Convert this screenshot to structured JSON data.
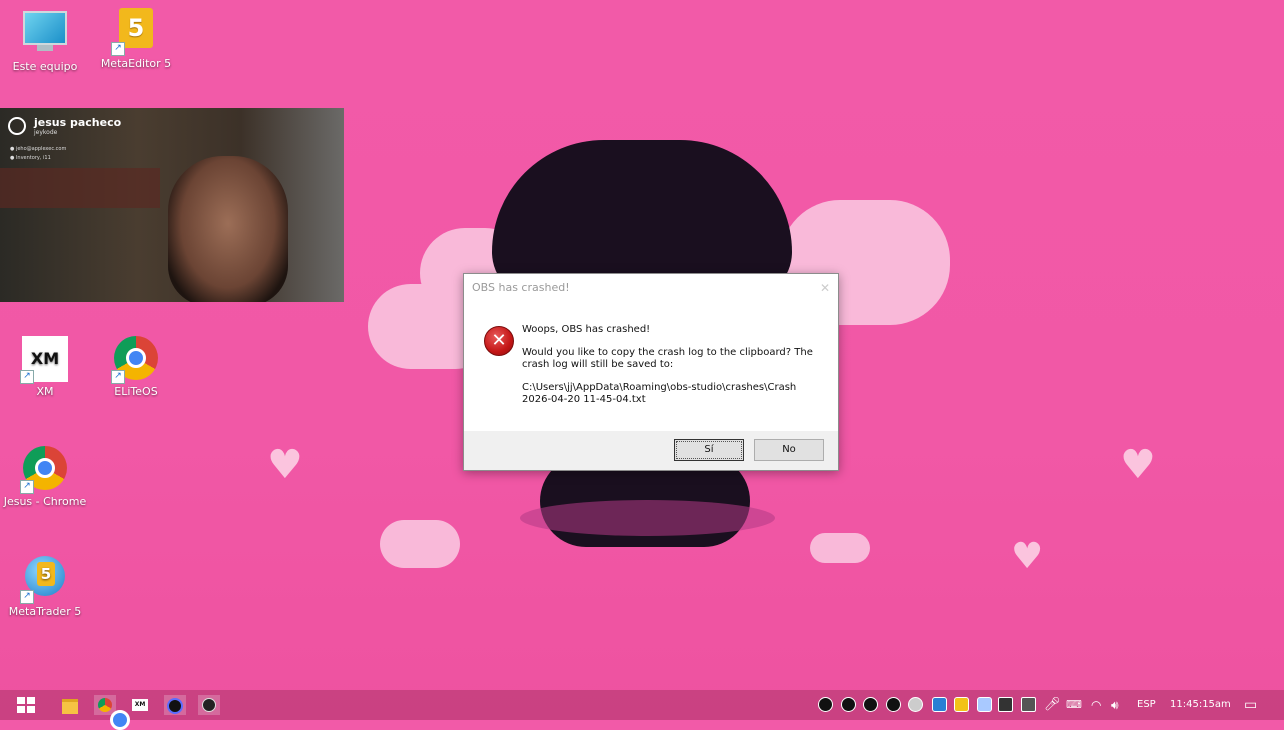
{
  "desktop": {
    "icons": [
      {
        "label": "Este equipo",
        "icon": "monitor-icon"
      },
      {
        "label": "MetaEditor 5",
        "icon": "metaeditor-icon"
      },
      {
        "label": "XM",
        "icon": "xm-icon"
      },
      {
        "label": "ELiTeOS",
        "icon": "chrome-icon"
      },
      {
        "label": "Jesus - Chrome",
        "icon": "chrome-icon"
      },
      {
        "label": "MetaTrader 5",
        "icon": "metatrader-icon"
      }
    ]
  },
  "webcam": {
    "name": "jesus pacheco",
    "handle": "jeykode",
    "line1": "● jeho@applexec.com",
    "line2": "● Inventory, i11"
  },
  "dialog": {
    "title": "OBS has crashed!",
    "close": "✕",
    "heading": "Woops, OBS has crashed!",
    "question": "Would you like to copy the crash log to the clipboard? The crash log will still be saved to:",
    "path": "C:\\Users\\jj\\AppData\\Roaming\\obs-studio\\crashes\\Crash 2026-04-20 11-45-04.txt",
    "yes_label": "Sí",
    "no_label": "No",
    "icon": "error-icon"
  },
  "taskbar": {
    "language": "ESP",
    "clock": "11:45:15am",
    "apps": [
      "start-icon",
      "file-explorer-icon",
      "chrome-icon",
      "xm-icon",
      "obs-circle-icon",
      "obs-icon"
    ]
  },
  "colors": {
    "wallpaper": "#f158a6",
    "taskbar": "#be3c78",
    "error_red": "#c41616"
  }
}
